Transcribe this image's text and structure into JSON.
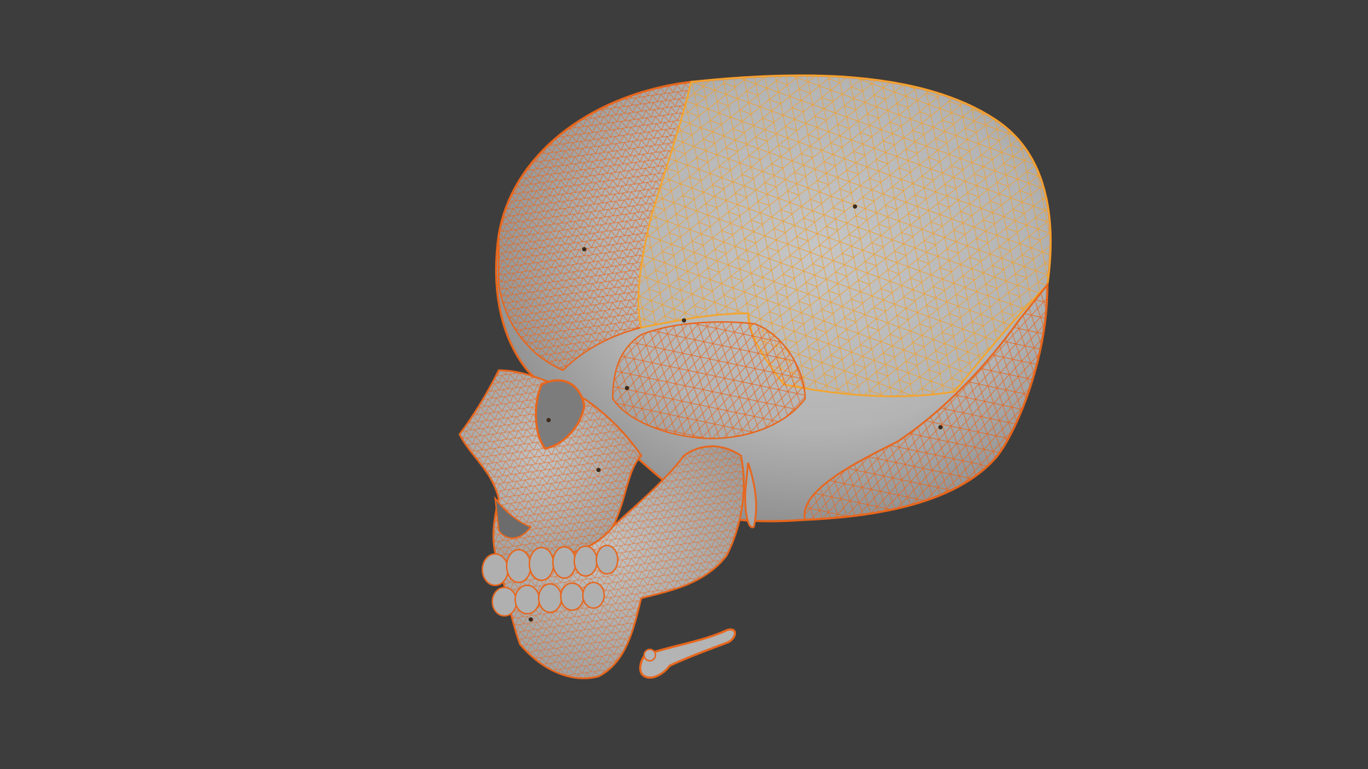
{
  "viewport": {
    "background": "#3d3d3d",
    "mesh_fill": "#b9b9b9",
    "mesh_shadow": "#8f8f8f",
    "wire_selected": "#e8661c",
    "wire_active": "#f2a531",
    "object": "skull-mesh",
    "display_mode": "solid-with-wireframe-overlay",
    "selection_state": "selected"
  }
}
